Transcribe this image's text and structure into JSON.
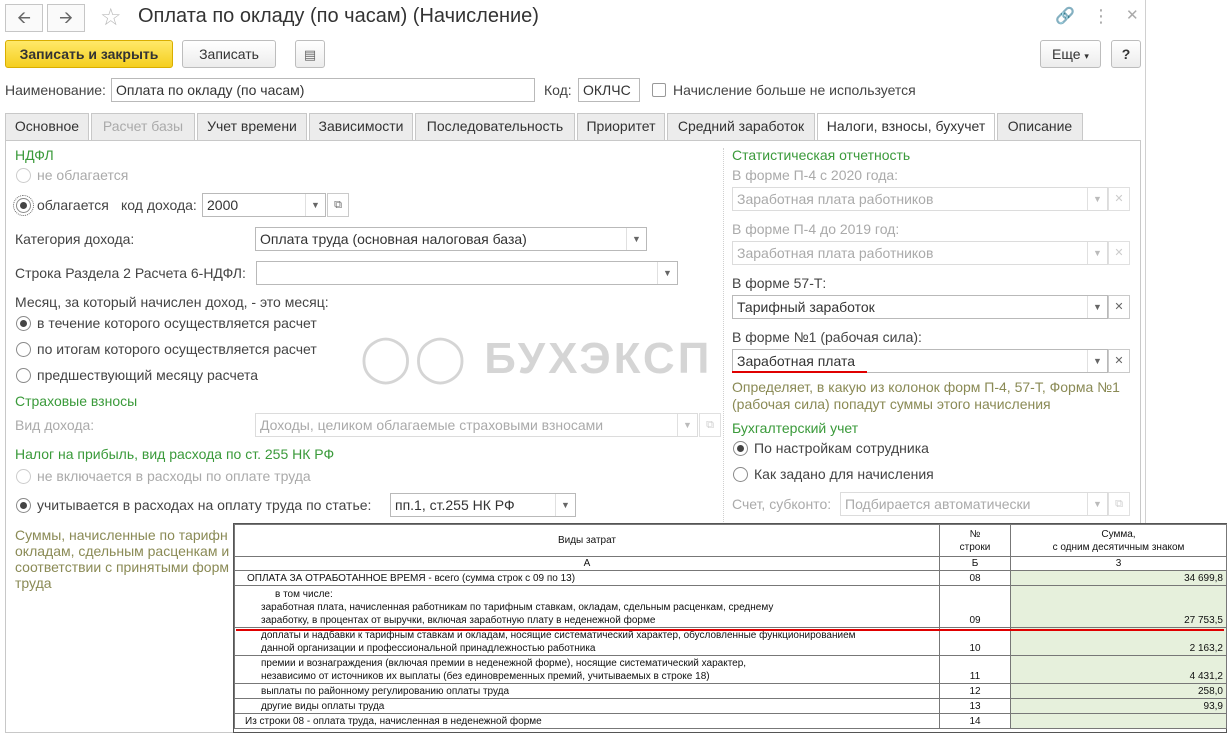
{
  "window": {
    "title": "Оплата по окладу (по часам) (Начисление)",
    "back_icon": "arrow-left-icon",
    "forward_icon": "arrow-right-icon"
  },
  "toolbar": {
    "save_close_label": "Записать и закрыть",
    "save_label": "Записать",
    "more_label": "Еще",
    "help_label": "?"
  },
  "header": {
    "name_label": "Наименование:",
    "name_value": "Оплата по окладу (по часам)",
    "code_label": "Код:",
    "code_value": "ОКЛЧС",
    "unused_label": "Начисление больше не используется"
  },
  "tabs": [
    {
      "label": "Основное"
    },
    {
      "label": "Расчет базы"
    },
    {
      "label": "Учет времени"
    },
    {
      "label": "Зависимости"
    },
    {
      "label": "Последовательность"
    },
    {
      "label": "Приоритет"
    },
    {
      "label": "Средний заработок"
    },
    {
      "label": "Налоги, взносы, бухучет"
    },
    {
      "label": "Описание"
    }
  ],
  "left": {
    "ndfl_title": "НДФЛ",
    "ndfl_not_taxed": "не облагается",
    "ndfl_taxed": "облагается",
    "income_code_label": "код дохода:",
    "income_code_value": "2000",
    "income_category_label": "Категория дохода:",
    "income_category_value": "Оплата труда (основная налоговая база)",
    "section2_label": "Строка Раздела 2 Расчета 6-НДФЛ:",
    "section2_value": "",
    "month_question": "Месяц, за который начислен доход, - это месяц:",
    "month_opt1": "в течение которого осуществляется расчет",
    "month_opt2": "по итогам которого осуществляется расчет",
    "month_opt3": "предшествующий месяцу расчета",
    "insurance_title": "Страховые взносы",
    "income_type_label": "Вид дохода:",
    "income_type_value": "Доходы, целиком облагаемые страховыми взносами",
    "profit_tax_title": "Налог на прибыль, вид расхода по ст. 255 НК РФ",
    "profit_not_included": "не включается в расходы по оплате труда",
    "profit_included": "учитывается в расходах на оплату труда по статье:",
    "profit_article_value": "пп.1, ст.255 НК РФ",
    "note_line1": "Суммы, начисленные по тарифн",
    "note_line2": "окладам, сдельным расценкам и",
    "note_line3": "соответствии с принятыми форм",
    "note_line4": "труда"
  },
  "right": {
    "stats_title": "Статистическая отчетность",
    "p4_2020_label": "В форме П-4 с 2020 года:",
    "p4_2020_value": "Заработная плата работников",
    "p4_2019_label": "В форме П-4 до 2019 год:",
    "p4_2019_value": "Заработная плата работников",
    "form57_label": "В форме 57-Т:",
    "form57_value": "Тарифный заработок",
    "form1_label": "В форме №1 (рабочая сила):",
    "form1_value": "Заработная плата",
    "hint_line1": "Определяет, в какую из колонок форм П-4, 57-Т, Форма №1",
    "hint_line2": "(рабочая сила) попадут суммы этого начисления",
    "accounting_title": "Бухгалтерский учет",
    "acc_opt1": "По настройкам сотрудника",
    "acc_opt2": "Как задано для начисления",
    "account_label": "Счет, субконто:",
    "account_value": "Подбирается автоматически"
  },
  "watermark": "БУХЭКСП",
  "table": {
    "headers": {
      "col1": "Виды затрат",
      "col2a": "№",
      "col2b": "строки",
      "col3a": "Сумма,",
      "col3b": "с одним десятичным знаком"
    },
    "letters": {
      "a": "А",
      "b": "Б",
      "c": "3"
    },
    "rows": [
      {
        "text": "ОПЛАТА ЗА ОТРАБОТАННОЕ ВРЕМЯ - всего (сумма строк с 09 по 13)",
        "code": "08",
        "sum": "34 699,8"
      },
      {
        "text1": "в том числе:",
        "text2": "заработная плата, начисленная работникам по тарифным ставкам, окладам, сдельным расценкам, среднему",
        "text3": "заработку, в процентах от выручки, включая заработную плату в неденежной форме",
        "code": "09",
        "sum": "27 753,5"
      },
      {
        "text1": "доплаты и надбавки к тарифным ставкам и окладам, носящие систематический характер, обусловленные функционированием",
        "text2": "данной организации и профессиональной принадлежностью работника",
        "code": "10",
        "sum": "2 163,2"
      },
      {
        "text1": "премии и вознаграждения (включая премии в неденежной форме), носящие систематический характер,",
        "text2": "независимо от источников их выплаты (без единовременных премий, учитываемых в строке 18)",
        "code": "11",
        "sum": "4 431,2"
      },
      {
        "text": "выплаты по районному регулированию оплаты труда",
        "code": "12",
        "sum": "258,0"
      },
      {
        "text": "другие виды оплаты труда",
        "code": "13",
        "sum": "93,9"
      },
      {
        "text": "Из строки 08 - оплата труда, начисленная в неденежной форме",
        "code": "14",
        "sum": ""
      }
    ]
  }
}
